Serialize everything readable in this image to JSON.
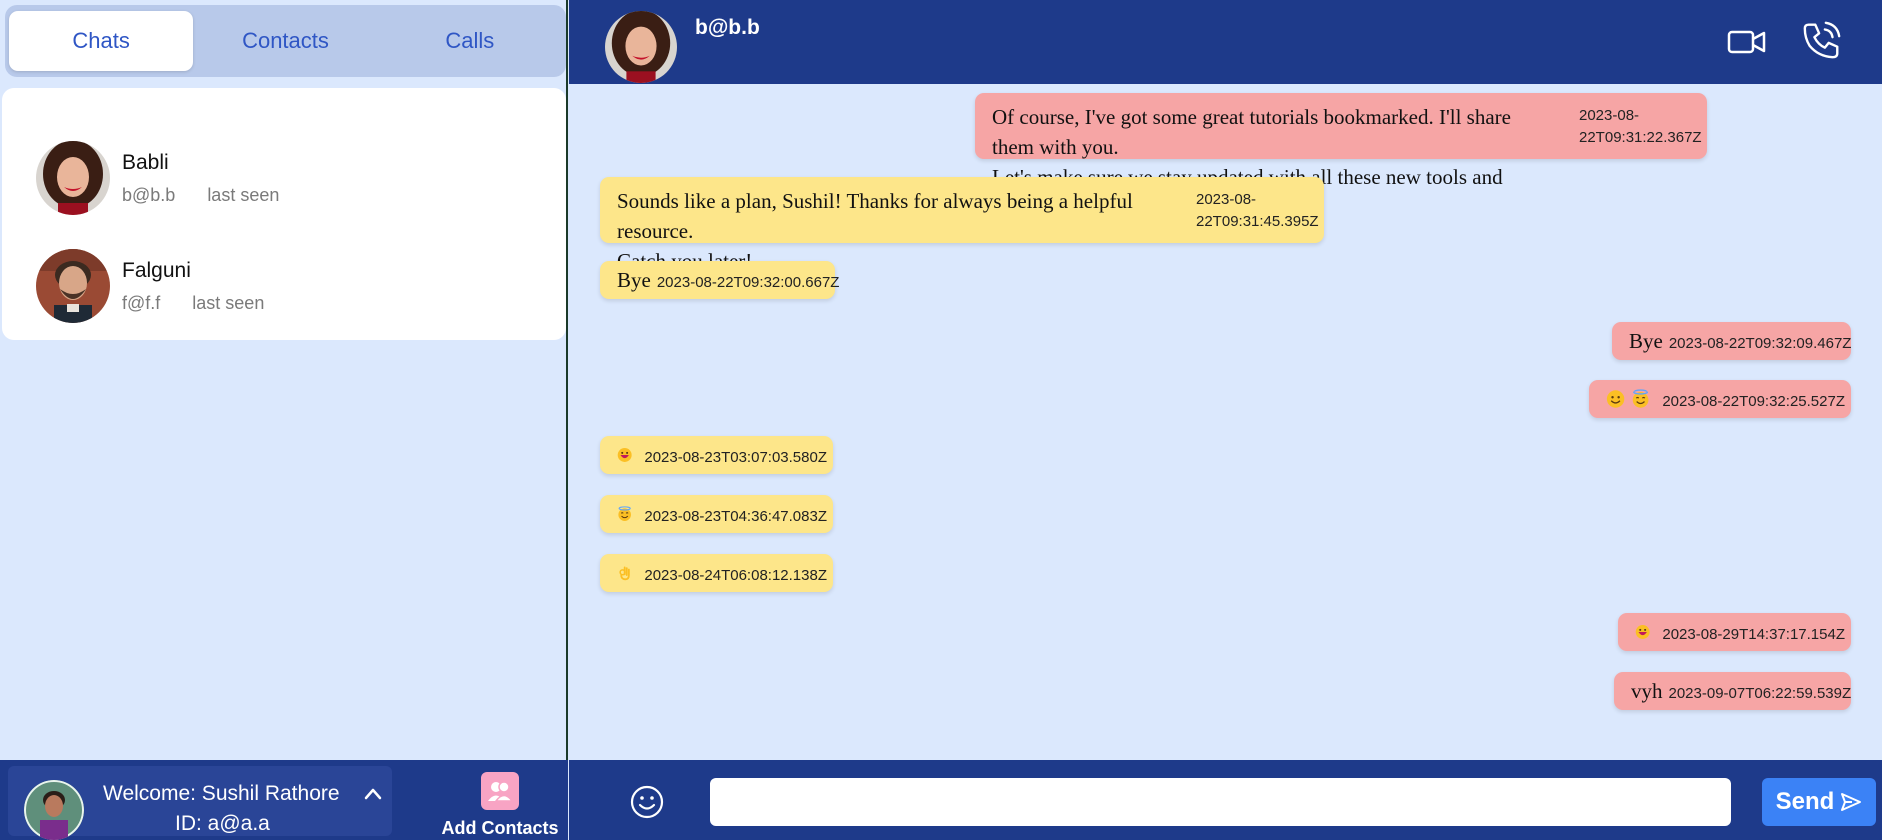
{
  "tabs": [
    {
      "label": "Chats",
      "active": true
    },
    {
      "label": "Contacts",
      "active": false
    },
    {
      "label": "Calls",
      "active": false
    }
  ],
  "chats": [
    {
      "name": "Babli",
      "email": "b@b.b",
      "status": "last seen",
      "avatar": "woman-red-lips-avatar"
    },
    {
      "name": "Falguni",
      "email": "f@f.f",
      "status": "last seen",
      "avatar": "man-beard-avatar"
    }
  ],
  "user": {
    "welcome": "Welcome: Sushil Rathore",
    "id": "ID: a@a.a"
  },
  "add_contacts_label": "Add Contacts",
  "header": {
    "name": "b@b.b"
  },
  "messages": [
    {
      "dir": "sent",
      "lines": [
        "Of course, I've got some great tutorials bookmarked. I'll share them with you.",
        "Let's make sure we stay updated with all these new tools and tricks!"
      ],
      "time": "2023-08-22T09:31:22.367Z"
    },
    {
      "dir": "recv",
      "lines": [
        "Sounds like a plan, Sushil! Thanks for always being a helpful resource.",
        "Catch you later!"
      ],
      "time": "2023-08-22T09:31:45.395Z"
    },
    {
      "dir": "recv",
      "text": "Bye",
      "time": "2023-08-22T09:32:00.667Z"
    },
    {
      "dir": "sent",
      "text": "Bye",
      "time": "2023-08-22T09:32:09.467Z"
    },
    {
      "dir": "sent",
      "emoji": [
        "smiling-face-icon",
        "halo-face-icon"
      ],
      "time": "2023-08-22T09:32:25.527Z"
    },
    {
      "dir": "recv",
      "emoji": [
        "grinning-face-icon"
      ],
      "time": "2023-08-23T03:07:03.580Z"
    },
    {
      "dir": "recv",
      "emoji": [
        "halo-face-icon"
      ],
      "time": "2023-08-23T04:36:47.083Z"
    },
    {
      "dir": "recv",
      "emoji": [
        "ok-hand-icon"
      ],
      "time": "2023-08-24T06:08:12.138Z"
    },
    {
      "dir": "sent",
      "emoji": [
        "grinning-face-icon"
      ],
      "time": "2023-08-29T14:37:17.154Z"
    },
    {
      "dir": "sent",
      "text": "vyh",
      "time": "2023-09-07T06:22:59.539Z"
    }
  ],
  "composer": {
    "placeholder": "",
    "send_label": "Send"
  },
  "colors": {
    "primary": "#1e3a8a",
    "background": "#dbe8fd",
    "sent_bubble": "#f6a5a5",
    "received_bubble": "#fde68a",
    "send_button": "#3b82f6"
  }
}
